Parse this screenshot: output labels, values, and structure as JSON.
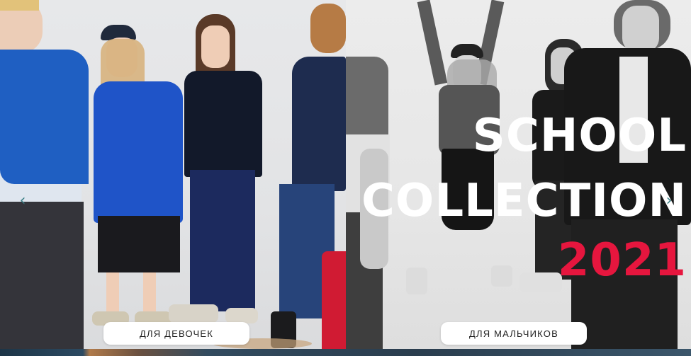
{
  "headline": {
    "line1": "SCHOOL",
    "line2": "COLLECTION",
    "line3": "2021"
  },
  "buttons": {
    "girls_label": "ДЛЯ ДЕВОЧЕК",
    "boys_label": "ДЛЯ МАЛЬЧИКОВ"
  },
  "carousel": {
    "prev_glyph": "‹",
    "next_glyph": "›"
  },
  "colors": {
    "accent": "#e6163e",
    "headline_text": "#ffffff",
    "arrow": "#3b7f86"
  },
  "icons": {
    "prev": "chevron-left-icon",
    "next": "chevron-right-icon"
  }
}
